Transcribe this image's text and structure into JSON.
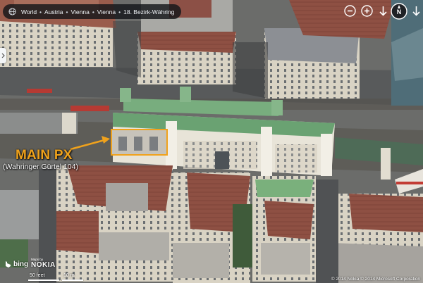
{
  "breadcrumb": {
    "items": [
      "World",
      "Austria",
      "Vienna",
      "Vienna",
      "18. Bezirk-Währing"
    ],
    "separator": "•"
  },
  "controls": {
    "zoom_out": "zoom-out",
    "zoom_in": "zoom-in",
    "rotate_left": "rotate-left",
    "rotate_right": "rotate-right",
    "compass_letter": "N"
  },
  "annotation": {
    "title": "MAIN PX",
    "subtitle": "(Wahringer Gürtel 104)",
    "accent_color": "#f0a21c"
  },
  "branding": {
    "bing": "bing",
    "nokia_prefix": "Maps by",
    "nokia": "NOKIA"
  },
  "scale": {
    "feet": "50 feet",
    "meters": "10 m"
  },
  "copyright": "© 2014 Nokia  © 2014 Microsoft Corporation"
}
